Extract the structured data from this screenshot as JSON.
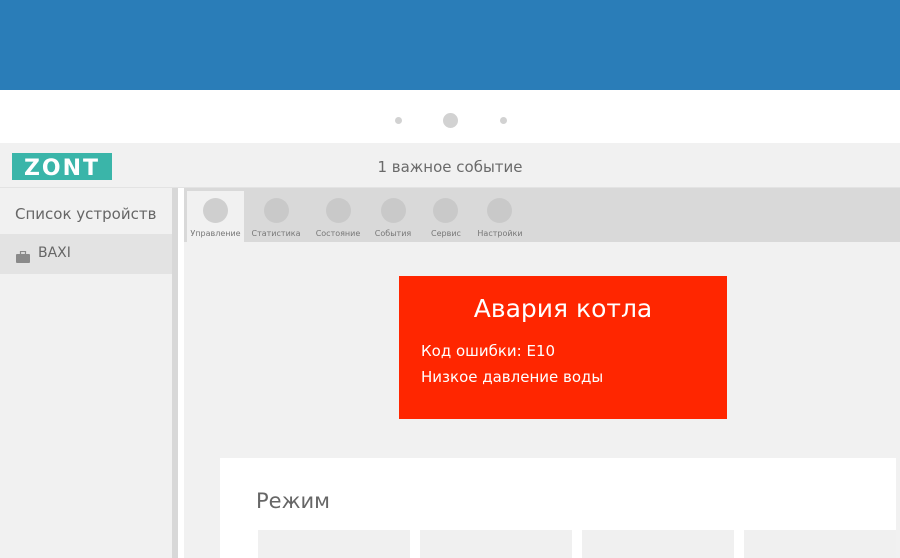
{
  "header": {
    "logo_text": "ZONT",
    "events_text": "1 важное событие"
  },
  "sidebar": {
    "title": "Список устройств",
    "devices": [
      {
        "label": "BAXI",
        "icon": "briefcase-icon"
      }
    ]
  },
  "tabs": [
    {
      "label": "Управление",
      "active": true
    },
    {
      "label": "Статистика",
      "active": false
    },
    {
      "label": "Состояние",
      "active": false
    },
    {
      "label": "События",
      "active": false
    },
    {
      "label": "Сервис",
      "active": false
    },
    {
      "label": "Настройки",
      "active": false
    }
  ],
  "alarm": {
    "title": "Авария котла",
    "code": "Код ошибки: E10",
    "description": "Низкое давление воды"
  },
  "mode": {
    "title": "Режим"
  },
  "colors": {
    "banner": "#2a7db8",
    "logo": "#3ab5a9",
    "alarm": "#ff2600"
  },
  "carousel": {
    "active_index": 1
  }
}
